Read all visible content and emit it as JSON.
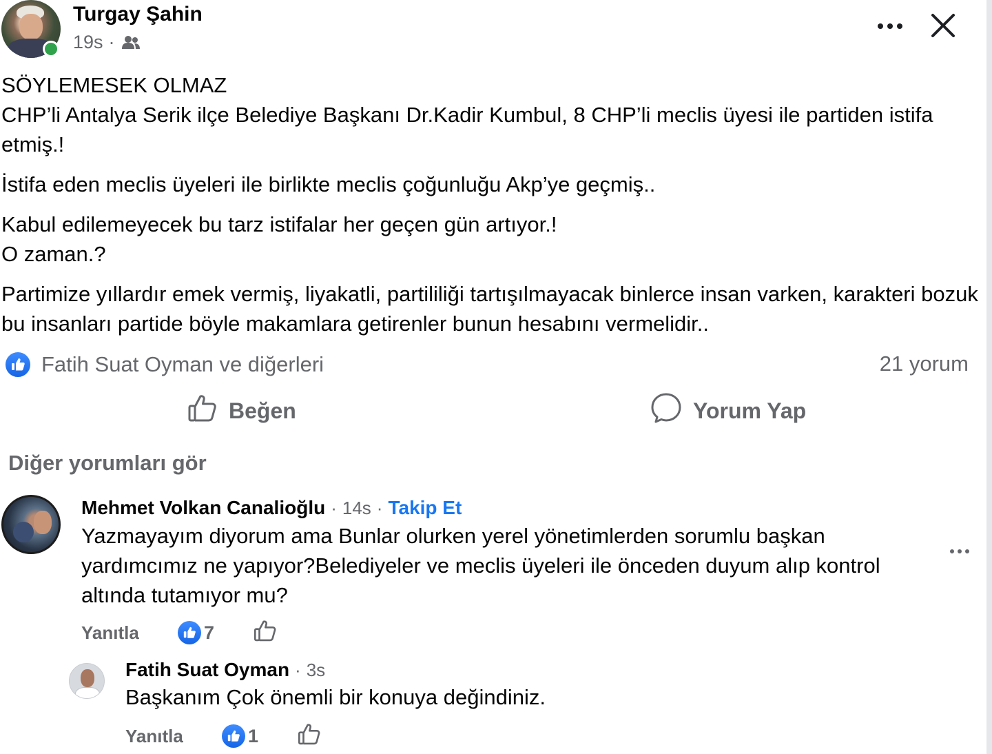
{
  "post": {
    "author": "Turgay Şahin",
    "time": "19s",
    "separator": "·",
    "audience_icon": "friends-icon",
    "paragraphs": [
      "SÖYLEMESEK OLMAZ\nCHP’li Antalya Serik ilçe Belediye Başkanı Dr.Kadir Kumbul, 8 CHP’li meclis üyesi ile partiden istifa etmiş.!",
      "İstifa eden meclis üyeleri ile birlikte meclis çoğunluğu Akp’ye geçmiş..",
      "Kabul edilemeyecek bu tarz istifalar her geçen gün artıyor.!\nO zaman.?",
      "Partimize yıllardır emek vermiş, liyakatli, partililiği tartışılmayacak binlerce insan varken, karakteri bozuk bu insanları partide böyle makamlara getirenler bunun hesabını vermelidir.."
    ],
    "reactions_text": "Fatih Suat Oyman ve diğerleri",
    "comment_count": "21 yorum"
  },
  "actions": {
    "like": "Beğen",
    "comment": "Yorum Yap"
  },
  "view_more": "Diğer yorumları gör",
  "comments": [
    {
      "name": "Mehmet Volkan Canalioğlu",
      "separator": "·",
      "time": "14s",
      "follow": "Takip Et",
      "text": "Yazmayayım diyorum ama Bunlar olurken yerel yönetimlerden sorumlu başkan yardımcımız ne yapıyor?Belediyeler ve meclis üyeleri ile önceden duyum alıp kontrol altında tutamıyor mu?",
      "reply": "Yanıtla",
      "like_count": "7"
    },
    {
      "name": "Fatih Suat Oyman",
      "separator": "·",
      "time": "3s",
      "text": "Başkanım Çok önemli bir konuya değindiniz.",
      "reply": "Yanıtla",
      "like_count": "1"
    }
  ],
  "colors": {
    "accent": "#1877f2",
    "secondary_text": "#65676b",
    "online": "#31a24c"
  }
}
